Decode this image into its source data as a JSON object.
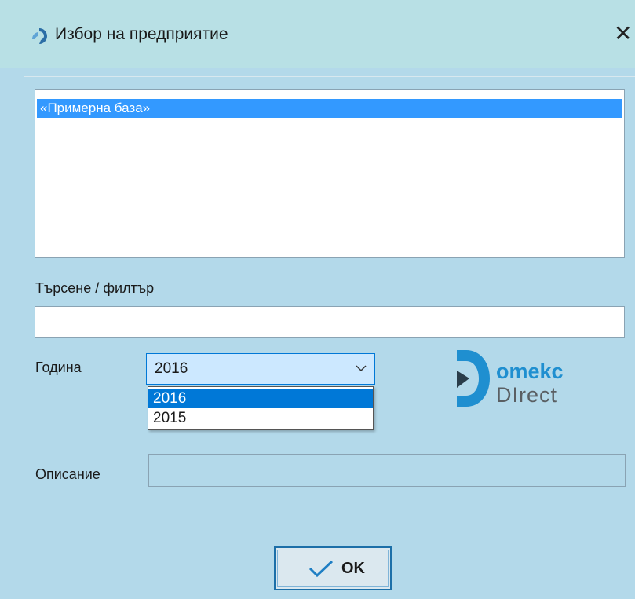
{
  "window": {
    "title": "Избор на предприятие",
    "close_symbol": "✕"
  },
  "company_list": {
    "items": [
      "«Примерна база»"
    ],
    "selected_index": 0
  },
  "filter": {
    "label": "Търсене / филтър",
    "value": ""
  },
  "year": {
    "label": "Година",
    "selected_value": "2016",
    "options": [
      "2016",
      "2015"
    ],
    "highlighted_option": "2016"
  },
  "logo": {
    "top_text": "omekc",
    "bottom_text": "DIrect",
    "colors": {
      "blue": "#1f8fd0",
      "gray": "#5a5f63"
    }
  },
  "description": {
    "label": "Описание",
    "value": ""
  },
  "ok_button": {
    "label": "OK"
  },
  "colors": {
    "window_background": "#b3d9ea",
    "titlebar_background": "#b8e0e5",
    "list_selection": "#3399ff",
    "dropdown_selection": "#0078d7"
  },
  "icons": {
    "app": "app-logo-icon",
    "close": "close-icon",
    "dropdown": "chevron-down-icon",
    "ok": "checkmark-icon"
  }
}
